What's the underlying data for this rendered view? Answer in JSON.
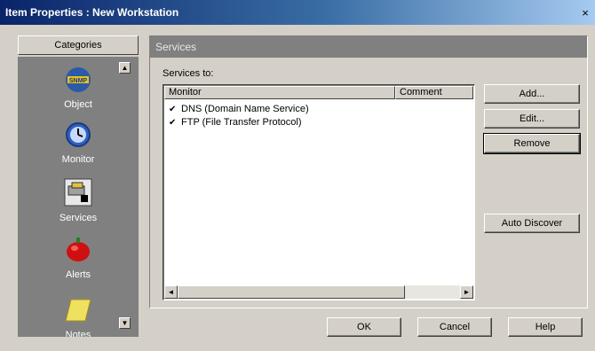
{
  "window": {
    "title": "Item Properties : New Workstation",
    "close_glyph": "×"
  },
  "categories": {
    "header": "Categories",
    "items": [
      {
        "label": "Object",
        "icon": "snmp-icon"
      },
      {
        "label": "Monitor",
        "icon": "clock-icon"
      },
      {
        "label": "Services",
        "icon": "services-icon"
      },
      {
        "label": "Alerts",
        "icon": "alert-icon"
      },
      {
        "label": "Notes",
        "icon": "notes-icon"
      }
    ],
    "selected": "Services",
    "scroll_up": "▲",
    "scroll_down": "▼"
  },
  "services": {
    "title": "Services",
    "list_label": "Services to:",
    "columns": [
      "Monitor",
      "Comment"
    ],
    "rows": [
      {
        "checked": true,
        "name": "DNS (Domain Name Service)",
        "comment": ""
      },
      {
        "checked": true,
        "name": "FTP (File Transfer Protocol)",
        "comment": ""
      }
    ],
    "check_glyph": "✔",
    "scroll_left": "◄",
    "scroll_right": "►",
    "buttons": {
      "add": "Add...",
      "edit": "Edit...",
      "remove": "Remove",
      "auto_discover": "Auto Discover"
    }
  },
  "dialog_buttons": {
    "ok": "OK",
    "cancel": "Cancel",
    "help": "Help"
  },
  "colors": {
    "face": "#d4d0c8",
    "panel_dark": "#808080",
    "title_start": "#0a246a"
  }
}
